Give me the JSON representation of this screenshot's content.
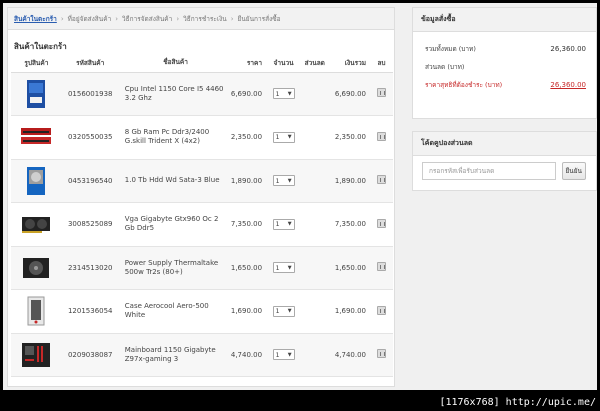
{
  "breadcrumb": [
    "สินค้าในตะกร้า",
    "ที่อยู่จัดส่งสินค้า",
    "วิธีการจัดส่งสินค้า",
    "วิธีการชำระเงิน",
    "ยืนยันการสั่งซื้อ"
  ],
  "cart": {
    "title": "สินค้าในตะกร้า",
    "headers": {
      "image": "รูปสินค้า",
      "code": "รหัสสินค้า",
      "name": "ชื่อสินค้า",
      "price": "ราคา",
      "qty": "จำนวน",
      "discount": "ส่วนลด",
      "total": "เงินรวม",
      "delete": "ลบ"
    },
    "items": [
      {
        "code": "0156001938",
        "name": "Cpu Intel 1150 Core I5 4460 3.2 Ghz",
        "price": "6,690.00",
        "qty": "1",
        "total": "6,690.00",
        "icon": "cpu-box"
      },
      {
        "code": "0320550035",
        "name": "8 Gb Ram Pc Ddr3/2400 G.skill Trident X (4x2)",
        "price": "2,350.00",
        "qty": "1",
        "total": "2,350.00",
        "icon": "ram-sticks"
      },
      {
        "code": "0453196540",
        "name": "1.0 Tb Hdd Wd Sata-3 Blue",
        "price": "1,890.00",
        "qty": "1",
        "total": "1,890.00",
        "icon": "hard-drive"
      },
      {
        "code": "3008525089",
        "name": "Vga Gigabyte Gtx960 Oc 2 Gb Ddr5",
        "price": "7,350.00",
        "qty": "1",
        "total": "7,350.00",
        "icon": "graphics-card"
      },
      {
        "code": "2314513020",
        "name": "Power Supply Thermaltake 500w Tr2s (80+)",
        "price": "1,650.00",
        "qty": "1",
        "total": "1,650.00",
        "icon": "power-supply"
      },
      {
        "code": "1201536054",
        "name": "Case Aerocool Aero-500 White",
        "price": "1,690.00",
        "qty": "1",
        "total": "1,690.00",
        "icon": "pc-case"
      },
      {
        "code": "0209038087",
        "name": "Mainboard 1150 Gigabyte Z97x-gaming 3",
        "price": "4,740.00",
        "qty": "1",
        "total": "4,740.00",
        "icon": "motherboard"
      }
    ]
  },
  "order": {
    "title": "ข้อมูลสั่งซื้อ",
    "subtotal_label": "รวมทั้งหมด (บาท)",
    "subtotal": "26,360.00",
    "discount_label": "ส่วนลด (บาท)",
    "discount": "",
    "grand_label": "ราคาสุทธิที่ต้องชำระ (บาท)",
    "grand": "26,360.00"
  },
  "coupon": {
    "title": "โค้ดคูปองส่วนลด",
    "placeholder": "กรอกรหัสเพื่อรับส่วนลด",
    "button": "ยืนยัน"
  },
  "footer": "[1176x768] http://upic.me/",
  "colors": {
    "accent": "#2a5db0",
    "grand_total": "#c62828"
  }
}
